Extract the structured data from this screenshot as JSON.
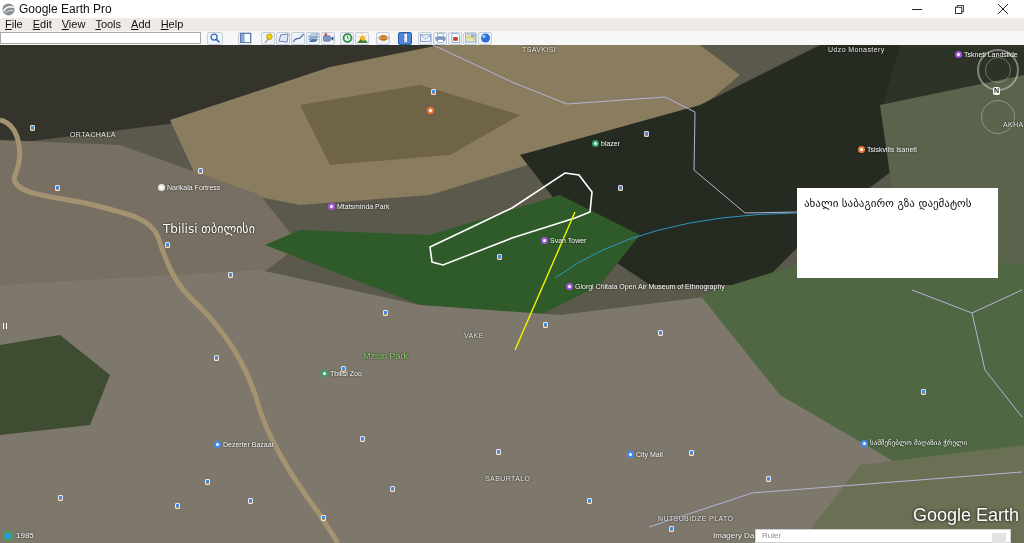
{
  "window": {
    "title": "Google Earth Pro"
  },
  "menu": [
    "File",
    "Edit",
    "View",
    "Tools",
    "Add",
    "Help"
  ],
  "toolbar": [
    {
      "kind": "sidebar",
      "on": false
    },
    {
      "kind": "placemark",
      "on": false
    },
    {
      "kind": "polygon",
      "on": false
    },
    {
      "kind": "path",
      "on": false
    },
    {
      "kind": "overlay",
      "on": false
    },
    {
      "kind": "tour",
      "on": false
    },
    {
      "kind": "history",
      "on": false
    },
    {
      "kind": "sun",
      "on": false
    },
    {
      "kind": "sky",
      "on": false
    },
    {
      "kind": "ruler",
      "on": true
    },
    {
      "kind": "email",
      "on": false
    },
    {
      "kind": "print",
      "on": false
    },
    {
      "kind": "save",
      "on": false
    },
    {
      "kind": "maps",
      "on": false
    },
    {
      "kind": "web",
      "on": false
    }
  ],
  "map": {
    "places": [
      {
        "label": "TSAVKISI",
        "kind": "area"
      },
      {
        "label": "Udzo Monastery",
        "kind": "area"
      },
      {
        "label": "Tskneti Landslide",
        "kind": "pin",
        "color": "#a455e0"
      },
      {
        "label": "AKHA",
        "kind": "area"
      },
      {
        "kind": "pin",
        "color": "#f07a3a"
      },
      {
        "label": "blazer",
        "kind": "pin",
        "color": "#33a46c"
      },
      {
        "label": "Tsiskvilis Isaneti",
        "kind": "pin",
        "color": "#f07a3a"
      },
      {
        "label": "ORTACHALA",
        "kind": "area"
      },
      {
        "label": "Narikala Fortress",
        "kind": "pin",
        "color": "#e6e6e6"
      },
      {
        "label": "Mtatsminda Park",
        "kind": "pin",
        "color": "#a455e0"
      },
      {
        "label": "Tbilisi თბილისი",
        "kind": "city"
      },
      {
        "label": "Svan Tower",
        "kind": "pin",
        "color": "#a455e0"
      },
      {
        "label": "Giorgi Chitaia Open Air Museum of Ethnography",
        "kind": "pin",
        "color": "#a455e0"
      },
      {
        "label": "VAKE",
        "kind": "area"
      },
      {
        "label": "Mziuri Park",
        "kind": "park"
      },
      {
        "label": "Tbilisi Zoo",
        "kind": "pin",
        "color": "#33a46c"
      },
      {
        "label": "Dezerter Bazaar",
        "kind": "pin",
        "color": "#3d8bf2"
      },
      {
        "label": "SABURTALO",
        "kind": "area"
      },
      {
        "label": "City Mall",
        "kind": "pin",
        "color": "#3d8bf2"
      },
      {
        "label": "სამშენებლო მაღაზია ჭრელი",
        "kind": "pin",
        "color": "#3d8bf2"
      },
      {
        "label": "NUTSUBIDZE PLATO",
        "kind": "area"
      }
    ],
    "callout": {
      "text": "ახალი საბაგირო გზა დაემატოს"
    },
    "navigation": {
      "north": "N"
    },
    "timeline": {
      "year": "1985"
    },
    "imagery_note": "Imagery Da",
    "logo": "Google Earth"
  },
  "ruler_panel": {
    "title": "Ruler"
  }
}
